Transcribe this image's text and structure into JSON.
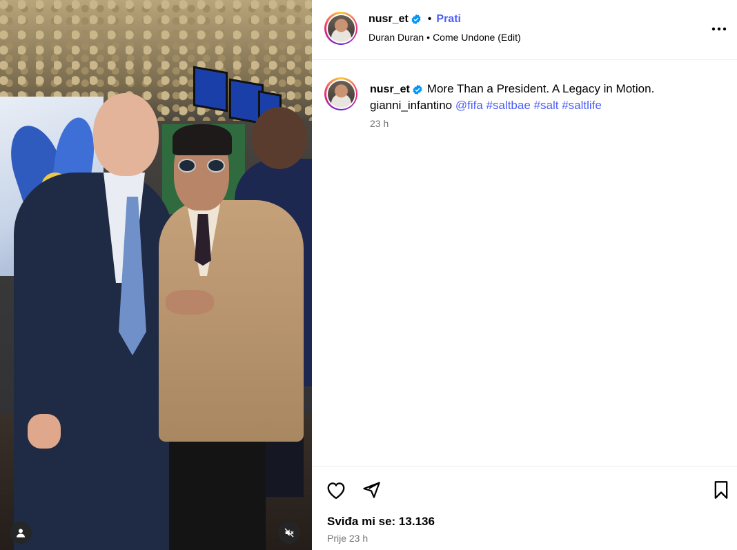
{
  "post": {
    "username": "nusr_et",
    "follow_label": "Prati",
    "header_separator": "•",
    "audio": {
      "artist": "Duran Duran",
      "separator": "•",
      "track": "Come Undone (Edit)"
    },
    "caption": {
      "text": "More Than a President. A Legacy in Motion.",
      "mention_plain": "gianni_infantino",
      "links": [
        "@fifa",
        "#saltbae",
        "#salt",
        "#saltlife"
      ],
      "time": "23 h"
    },
    "likes_text": "Sviđa mi se: 13.136",
    "posted_ago": "Prije 23 h"
  },
  "icons": {
    "verified": "verified-badge-icon",
    "more": "more-options-icon",
    "like": "heart-icon",
    "share": "send-icon",
    "save": "bookmark-icon",
    "tag": "user-tag-icon",
    "mute": "sound-off-icon"
  },
  "colors": {
    "accent_blue": "#4a5df9",
    "verified_blue": "#0095f6",
    "secondary_text": "#737373",
    "divider": "#efefef"
  }
}
